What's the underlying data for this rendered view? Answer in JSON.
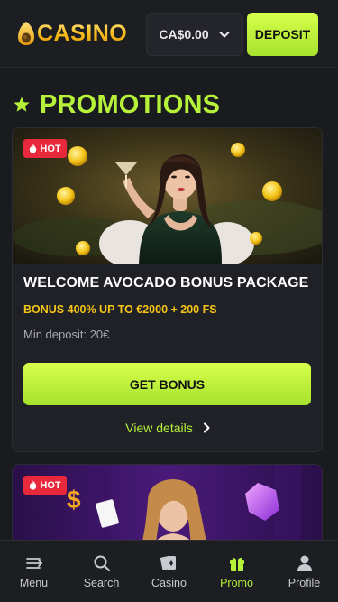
{
  "header": {
    "logo_text": "CASINO",
    "balance": "CA$0.00",
    "deposit_label": "DEPOSIT"
  },
  "section": {
    "title": "PROMOTIONS"
  },
  "promo_cards": [
    {
      "badge": "HOT",
      "title": "WELCOME AVOCADO BONUS PACKAGE",
      "subtitle": "BONUS 400% UP TO €2000 + 200 FS",
      "min_deposit": "Min deposit: 20€",
      "cta_label": "GET BONUS",
      "details_label": "View details"
    },
    {
      "badge": "HOT"
    }
  ],
  "bottom_nav": {
    "items": [
      {
        "label": "Menu",
        "icon": "menu-icon"
      },
      {
        "label": "Search",
        "icon": "search-icon"
      },
      {
        "label": "Casino",
        "icon": "cards-icon"
      },
      {
        "label": "Promo",
        "icon": "gift-icon",
        "active": true
      },
      {
        "label": "Profile",
        "icon": "user-icon"
      }
    ]
  },
  "colors": {
    "accent": "#b6f23a",
    "gold": "#f5c518",
    "hot": "#e8283b",
    "background": "#1a1b1f"
  }
}
